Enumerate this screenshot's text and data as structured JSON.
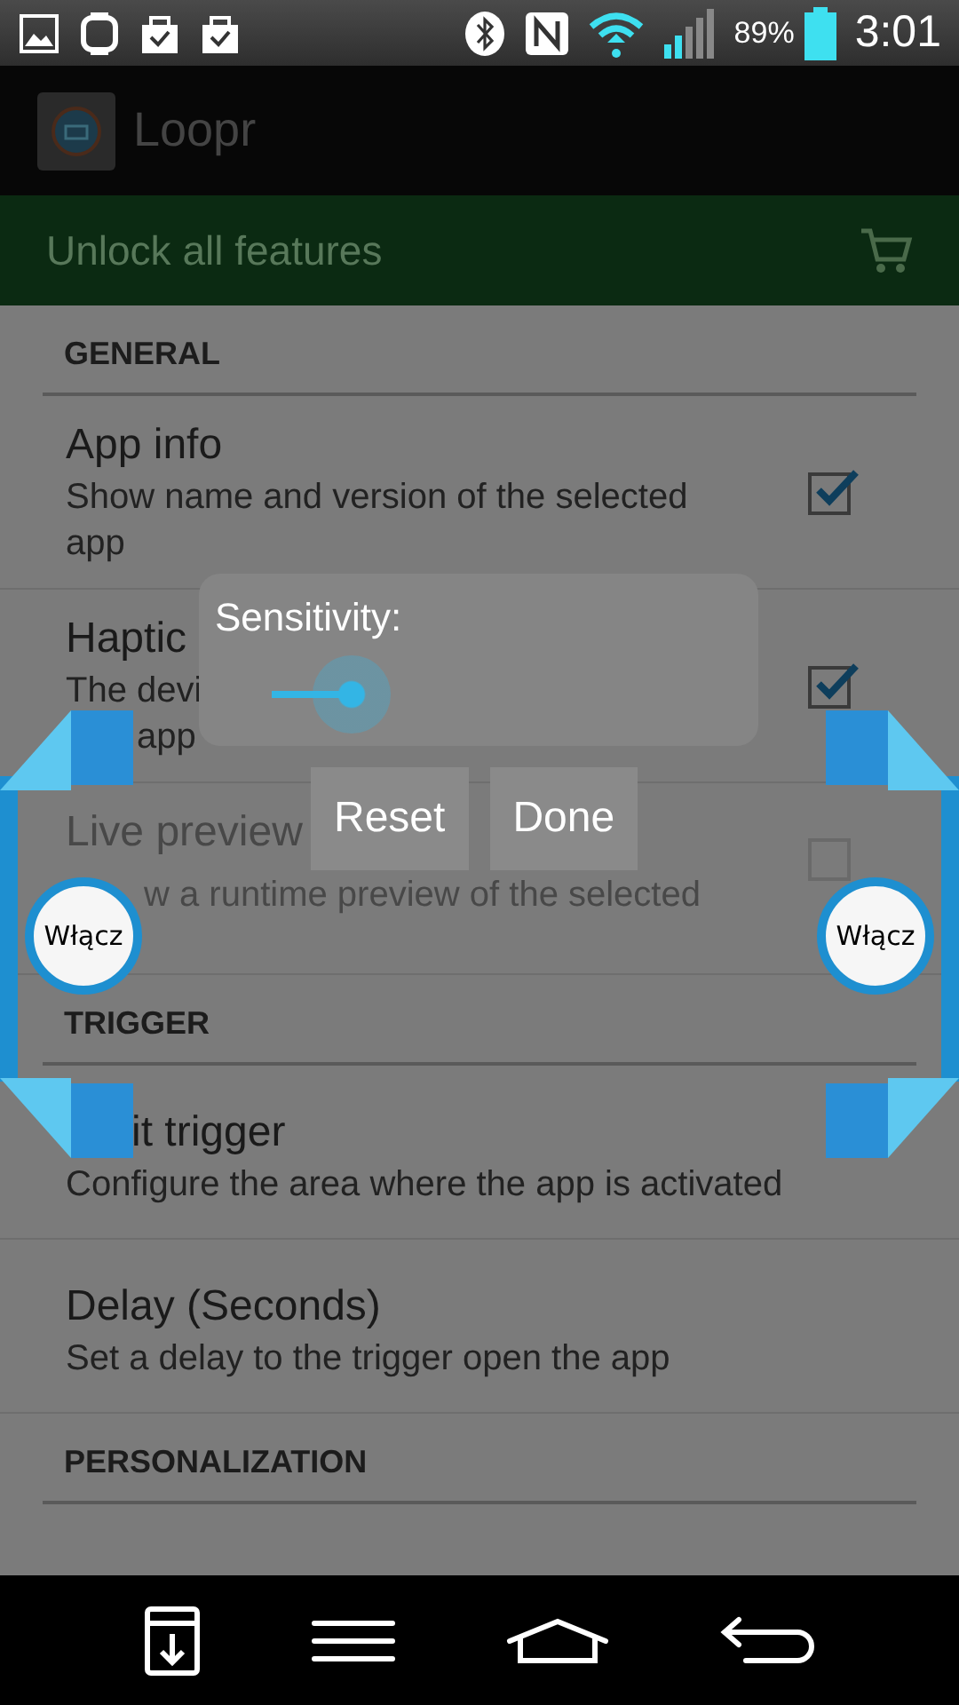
{
  "status_bar": {
    "battery_text": "89%",
    "time": "3:01"
  },
  "app_bar": {
    "title": "Loopr"
  },
  "promo": {
    "label": "Unlock all features"
  },
  "settings": [
    {
      "kind": "header",
      "title": "GENERAL"
    },
    {
      "kind": "item",
      "title": "App info",
      "summary": "Show name and version of the selected app",
      "checked": true,
      "disabled": false
    },
    {
      "kind": "item",
      "title": "Haptic",
      "summary": "The devi",
      "summary_tail": "app",
      "checked": true,
      "disabled": false
    },
    {
      "kind": "item",
      "title": "Live preview",
      "summary": "w a runtime preview of the selected",
      "checked": false,
      "disabled": true
    },
    {
      "kind": "header",
      "title": "TRIGGER"
    },
    {
      "kind": "item",
      "title": "it trigger",
      "summary": "Configure the area where the app is activated",
      "disabled": false
    },
    {
      "kind": "item",
      "title": "Delay (Seconds)",
      "summary": "Set a delay to the trigger open the app",
      "disabled": false
    },
    {
      "kind": "header",
      "title": "PERSONALIZATION"
    }
  ],
  "dialog": {
    "label": "Sensitivity:",
    "level": 0.18
  },
  "buttons": [
    "Reset",
    "Done"
  ],
  "handles": [
    {
      "label": "Włącz"
    },
    {
      "label": "Włącz"
    }
  ]
}
